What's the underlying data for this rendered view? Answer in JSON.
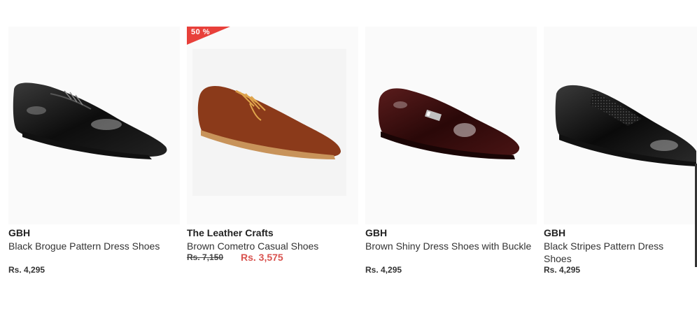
{
  "products": [
    {
      "brand": "GBH",
      "name": "Black Brogue Pattern Dress Shoes",
      "price": "Rs. 4,295",
      "image_icon": "black-brogue-shoe-image"
    },
    {
      "brand": "The Leather Crafts",
      "name": "Brown Cometro Casual Shoes",
      "original_price": "Rs. 7,150",
      "sale_price": "Rs. 3,575",
      "discount_badge": "50 %",
      "badge_color": "#e8403a",
      "sale_color": "#d9534f",
      "image_icon": "brown-suede-shoe-image"
    },
    {
      "brand": "GBH",
      "name": "Brown Shiny Dress Shoes with Buckle",
      "price": "Rs. 4,295",
      "image_icon": "brown-buckle-shoe-image"
    },
    {
      "brand": "GBH",
      "name": "Black Stripes Pattern Dress Shoes",
      "price": "Rs. 4,295",
      "image_icon": "black-stripes-shoe-image"
    }
  ]
}
